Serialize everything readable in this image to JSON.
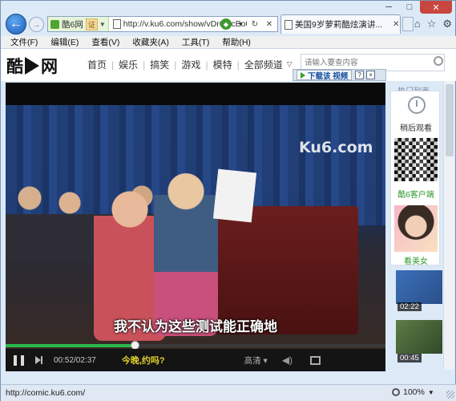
{
  "browser": {
    "site_chip_label": "酷6网",
    "cert_label": "证",
    "url": "http://v.ku6.com/show/vDr6mcEo0-jG",
    "tab_title": "美国9岁萝莉酷炫演讲...",
    "menu": [
      "文件(F)",
      "编辑(E)",
      "查看(V)",
      "收藏夹(A)",
      "工具(T)",
      "帮助(H)"
    ]
  },
  "site": {
    "logo_left": "酷",
    "logo_right": "网",
    "nav": [
      "首页",
      "娱乐",
      "搞笑",
      "游戏",
      "模特",
      "全部频道"
    ],
    "search_placeholder": "请输入要查内容"
  },
  "download_bar": {
    "button_label": "下载该 视频",
    "help": "?",
    "close": "×"
  },
  "video": {
    "watermark": "Ku6.com",
    "subtitle": "我不认为这些测试能正确地",
    "time": "00:52/02:37",
    "progress_fraction": 0.339,
    "promo_text": "今晚,约吗?",
    "quality_label": "高清"
  },
  "sidebar": {
    "top_label": "热门列表",
    "later_label": "稍后观看",
    "client_label": "酷6客户端",
    "beauty_label": "看美女",
    "thumb_times": [
      "02:22",
      "00:45"
    ]
  },
  "status": {
    "url": "http://comic.ku6.com/",
    "zoom": "100%"
  },
  "colors": {
    "accent_green": "#29b94a",
    "promo_yellow": "#e2d02a",
    "link_green": "#2e9a2a"
  }
}
